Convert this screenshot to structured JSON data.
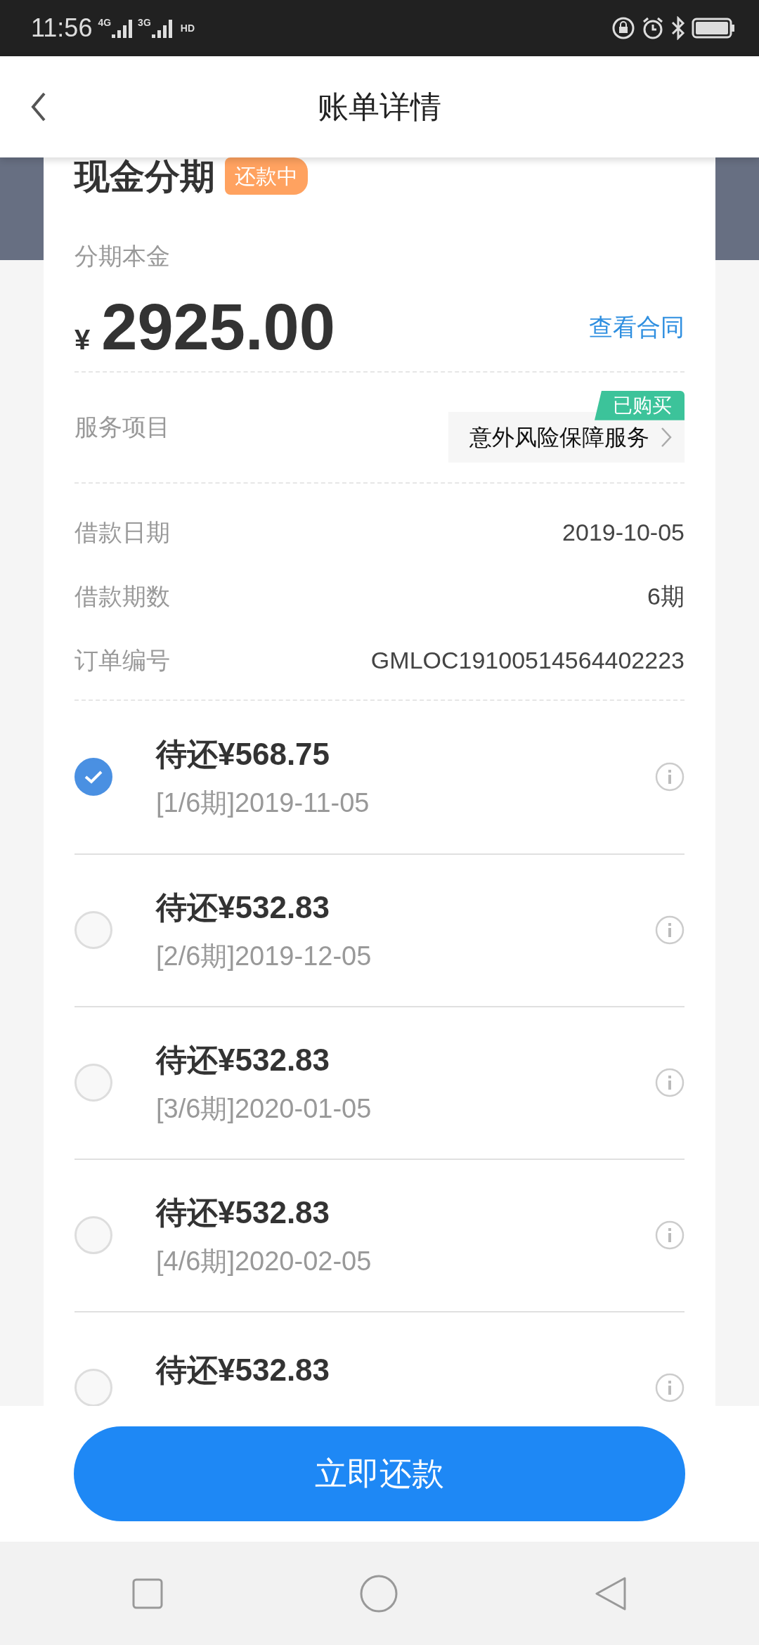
{
  "status_bar": {
    "time": "11:56",
    "signals": [
      "4G",
      "3G"
    ],
    "hd": "HD"
  },
  "header": {
    "title": "账单详情"
  },
  "loan": {
    "title": "现金分期",
    "status": "还款中",
    "principal_label": "分期本金",
    "currency": "¥",
    "principal": "2925.00",
    "contract_link": "查看合同",
    "service": {
      "label": "服务项目",
      "name": "意外风险保障服务",
      "tag": "已购买"
    },
    "details": [
      {
        "label": "借款日期",
        "value": "2019-10-05"
      },
      {
        "label": "借款期数",
        "value": "6期"
      },
      {
        "label": "订单编号",
        "value": "GMLOC19100514564402223"
      }
    ]
  },
  "installments": [
    {
      "amount": "待还¥568.75",
      "period": "[1/6期]2019-11-05",
      "selected": true
    },
    {
      "amount": "待还¥532.83",
      "period": "[2/6期]2019-12-05",
      "selected": false
    },
    {
      "amount": "待还¥532.83",
      "period": "[3/6期]2020-01-05",
      "selected": false
    },
    {
      "amount": "待还¥532.83",
      "period": "[4/6期]2020-02-05",
      "selected": false
    },
    {
      "amount": "待还¥532.83",
      "selected": false
    }
  ],
  "pay_button": "立即还款"
}
